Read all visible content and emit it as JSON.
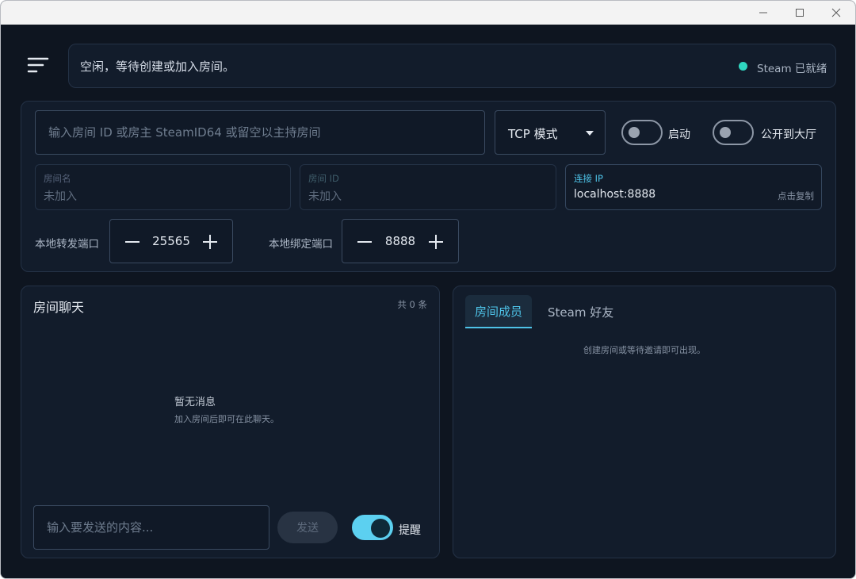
{
  "window": {
    "controls": {
      "minimize": "minimize-icon",
      "maximize": "maximize-icon",
      "close": "close-icon"
    }
  },
  "header": {
    "menu_icon": "menu-icon",
    "status_text": "空闲，等待创建或加入房间。",
    "steam_status": "Steam 已就绪",
    "steam_dot_color": "#2fd6c0"
  },
  "config": {
    "room_input": {
      "value": "",
      "placeholder": "输入房间 ID 或房主 SteamID64 或留空以主持房间"
    },
    "mode": {
      "selected": "TCP 模式"
    },
    "toggles": {
      "start": {
        "label": "启动",
        "on": false
      },
      "public": {
        "label": "公开到大厅",
        "on": false
      }
    },
    "info": {
      "room_name": {
        "caption": "房间名",
        "value": "未加入"
      },
      "room_id": {
        "caption": "房间 ID",
        "value": "未加入"
      },
      "connect_ip": {
        "caption": "连接 IP",
        "value": "localhost:8888",
        "copy_hint": "点击复制"
      }
    },
    "ports": {
      "forward": {
        "label": "本地转发端口",
        "value": "25565"
      },
      "bind": {
        "label": "本地绑定端口",
        "value": "8888"
      }
    }
  },
  "chat": {
    "title": "房间聊天",
    "count": "共 0 条",
    "empty_title": "暂无消息",
    "empty_subtitle": "加入房间后即可在此聊天。",
    "input": {
      "value": "",
      "placeholder": "输入要发送的内容..."
    },
    "send_label": "发送",
    "remind": {
      "label": "提醒",
      "on": true
    }
  },
  "members": {
    "tabs": [
      {
        "label": "房间成员",
        "active": true
      },
      {
        "label": "Steam 好友",
        "active": false
      }
    ],
    "empty_text": "创建房间或等待邀请即可出现。"
  },
  "colors": {
    "accent": "#4ec3e8",
    "background": "#0e1520",
    "panel": "#121c2b"
  }
}
